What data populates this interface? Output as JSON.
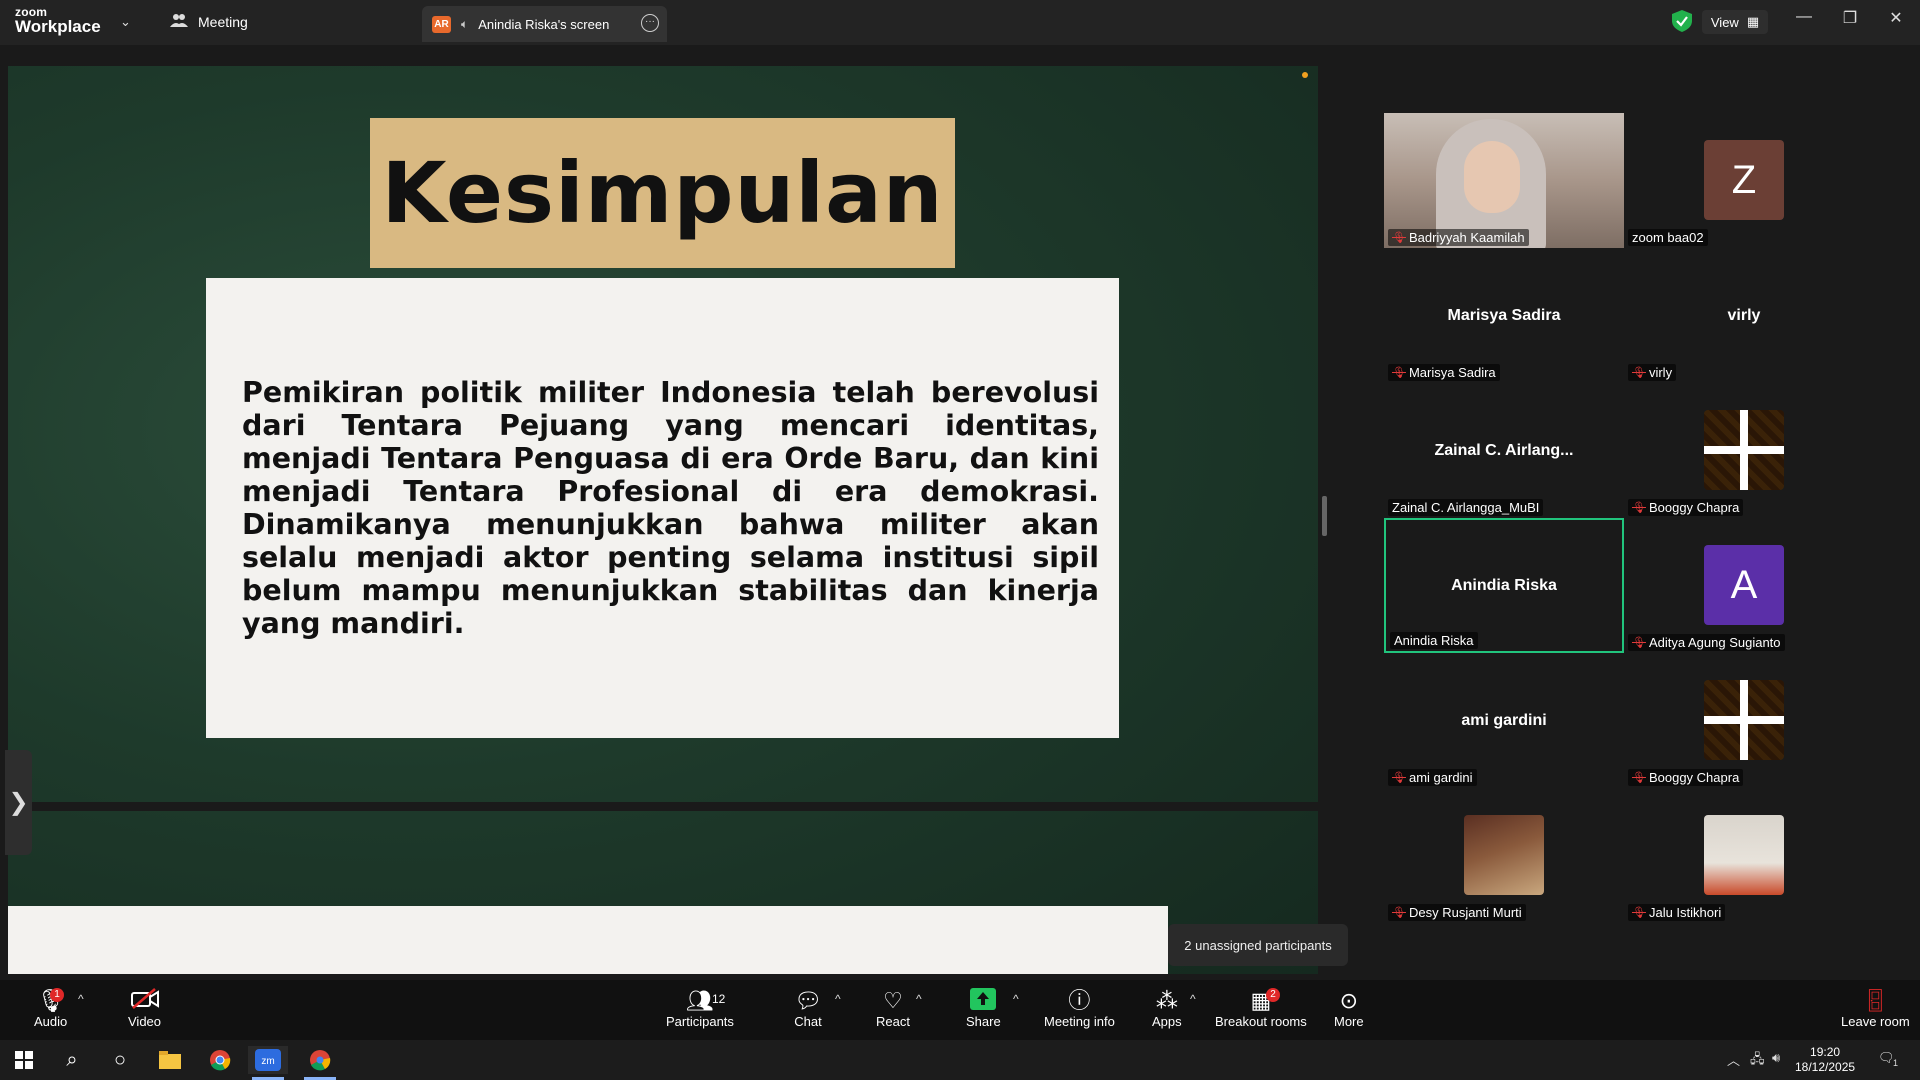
{
  "app": {
    "brand_line1": "zoom",
    "brand_line2": "Workplace",
    "meeting_tab": "Meeting",
    "screen_tab_initials": "AR",
    "screen_tab_label": "Anindia Riska's screen",
    "view_label": "View",
    "shield_color": "#22b14c"
  },
  "slide": {
    "title": "Kesimpulan",
    "body": "Pemikiran politik militer Indonesia telah berevolusi dari Tentara Pejuang yang mencari identitas, menjadi Tentara Penguasa di era Orde Baru, dan kini menjadi Tentara Profesional di era demokrasi. Dinamikanya menunjukkan bahwa militer akan selalu menjadi aktor penting selama institusi sipil belum mampu menunjukkan stabilitas dan kinerja yang mandiri."
  },
  "gallery": {
    "tiles": [
      {
        "label": "Badriyyah Kaamilah",
        "muted": true,
        "kind": "video"
      },
      {
        "label": "zoom baa02",
        "muted": false,
        "kind": "avatar",
        "letter": "Z",
        "color": "#6b3f35"
      },
      {
        "label": "Marisya Sadira",
        "muted": true,
        "kind": "name",
        "big": "Marisya Sadira"
      },
      {
        "label": "virly",
        "muted": true,
        "kind": "name",
        "big": "virly"
      },
      {
        "label": "Zainal C. Airlangga_MuBI",
        "muted": false,
        "kind": "name",
        "big": "Zainal C. Airlang..."
      },
      {
        "label": "Booggy Chapra",
        "muted": true,
        "kind": "pattern"
      },
      {
        "label": "Anindia Riska",
        "muted": false,
        "kind": "name",
        "big": "Anindia Riska",
        "active": true
      },
      {
        "label": "Aditya Agung Sugianto",
        "muted": true,
        "kind": "avatar",
        "letter": "A",
        "color": "#5b2fa8"
      },
      {
        "label": "ami gardini",
        "muted": true,
        "kind": "name",
        "big": "ami gardini"
      },
      {
        "label": "Booggy Chapra",
        "muted": true,
        "kind": "pattern"
      },
      {
        "label": "Desy Rusjanti Murti",
        "muted": true,
        "kind": "photo"
      },
      {
        "label": "Jalu Istikhori",
        "muted": true,
        "kind": "photo2"
      }
    ],
    "tooltip": "2 unassigned participants"
  },
  "toolbar": {
    "audio": "Audio",
    "video": "Video",
    "participants": "Participants",
    "participants_count": "12",
    "chat": "Chat",
    "react": "React",
    "share": "Share",
    "meeting_info": "Meeting info",
    "apps": "Apps",
    "breakout_rooms": "Breakout rooms",
    "breakout_badge": "2",
    "more": "More",
    "leave": "Leave room",
    "audio_badge": "1",
    "share_color": "#22c55e"
  },
  "taskbar": {
    "time": "19:20",
    "date": "18/12/2025",
    "notif_count": "1"
  }
}
